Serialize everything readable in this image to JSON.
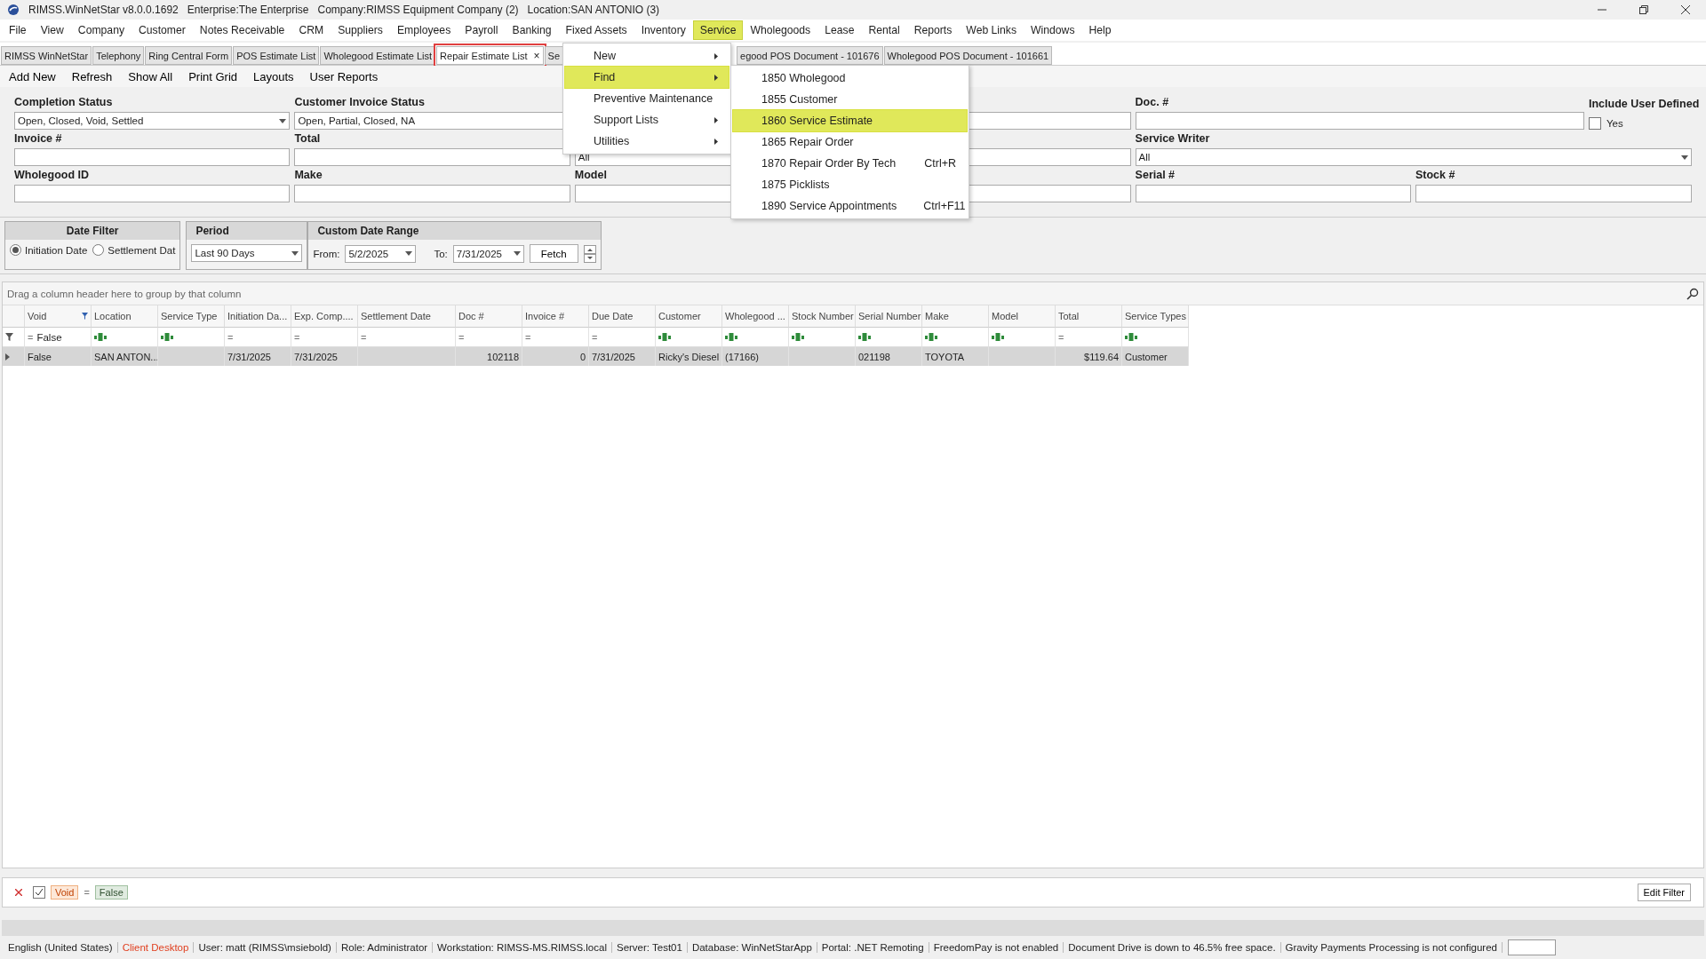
{
  "window": {
    "title": "RIMSS.WinNetStar v8.0.0.1692",
    "context": [
      "Enterprise:The Enterprise",
      "Company:RIMSS Equipment Company (2)",
      "Location:SAN ANTONIO (3)"
    ]
  },
  "menu_bar": [
    {
      "label": "File",
      "selected": false
    },
    {
      "label": "View",
      "selected": false
    },
    {
      "label": "Company",
      "selected": false
    },
    {
      "label": "Customer",
      "selected": false
    },
    {
      "label": "Notes Receivable",
      "selected": false
    },
    {
      "label": "CRM",
      "selected": false
    },
    {
      "label": "Suppliers",
      "selected": false
    },
    {
      "label": "Employees",
      "selected": false
    },
    {
      "label": "Payroll",
      "selected": false
    },
    {
      "label": "Banking",
      "selected": false
    },
    {
      "label": "Fixed Assets",
      "selected": false
    },
    {
      "label": "Inventory",
      "selected": false
    },
    {
      "label": "Service",
      "selected": true
    },
    {
      "label": "Wholegoods",
      "selected": false
    },
    {
      "label": "Lease",
      "selected": false
    },
    {
      "label": "Rental",
      "selected": false
    },
    {
      "label": "Reports",
      "selected": false
    },
    {
      "label": "Web Links",
      "selected": false
    },
    {
      "label": "Windows",
      "selected": false
    },
    {
      "label": "Help",
      "selected": false
    }
  ],
  "tabs": [
    {
      "label": "RIMSS WinNetStar",
      "selected": false
    },
    {
      "label": "Telephony",
      "selected": false
    },
    {
      "label": "Ring Central Form",
      "selected": false
    },
    {
      "label": "POS Estimate List",
      "selected": false
    },
    {
      "label": "Wholegood Estimate List",
      "selected": false
    },
    {
      "label": "Repair Estimate List",
      "selected": true,
      "close": "×"
    },
    {
      "label": "Se",
      "selected": false
    },
    {
      "label": "egood POS Document - 101676",
      "selected": false
    },
    {
      "label": "Wholegood POS Document - 101661",
      "selected": false
    }
  ],
  "toolbar": [
    "Add New",
    "Refresh",
    "Show All",
    "Print Grid",
    "Layouts",
    "User Reports"
  ],
  "filter_form": [
    [
      {
        "kind": "dropdown",
        "label": "Completion Status",
        "value": "Open, Closed, Void, Settled"
      },
      {
        "kind": "text",
        "label": "Customer Invoice Status",
        "value": "Open, Partial, Closed, NA"
      },
      {
        "kind": "text"
      },
      {
        "kind": "text",
        "label": "Doc. #"
      },
      {
        "kind": "checkbox",
        "label": "Include User Defined",
        "option": "Yes",
        "checked": false
      }
    ],
    [
      {
        "kind": "text",
        "label": "Invoice #"
      },
      {
        "kind": "text",
        "label": "Total"
      },
      {
        "kind": "dropdown",
        "value": "All"
      },
      {
        "kind": "text"
      },
      {
        "kind": "dropdown",
        "label": "Service Writer",
        "value": "All"
      }
    ],
    [
      {
        "kind": "text",
        "label": "Wholegood ID"
      },
      {
        "kind": "text",
        "label": "Make"
      },
      {
        "kind": "text",
        "label": "Model"
      },
      {
        "kind": "text"
      },
      {
        "kind": "text",
        "label": "Serial #"
      },
      {
        "kind": "text",
        "label": "Stock #"
      }
    ]
  ],
  "date_filter": {
    "title": "Date Filter",
    "options": [
      {
        "label": "Initiation Date",
        "selected": true
      },
      {
        "label": "Settlement Dat",
        "selected": false
      }
    ],
    "period_title": "Period",
    "period": "Last 90 Days",
    "range_title": "Custom Date Range",
    "from_label": "From:",
    "from": "5/2/2025",
    "to_label": "To:",
    "to": "7/31/2025",
    "fetch": "Fetch"
  },
  "grid": {
    "group_hint": "Drag a column header here to group by that column",
    "columns": [
      {
        "label": "Void",
        "filtered": true
      },
      {
        "label": "Location",
        "filtered": false
      },
      {
        "label": "Service Type",
        "filtered": false
      },
      {
        "label": "Initiation Da...",
        "filtered": false
      },
      {
        "label": "Exp. Comp....",
        "filtered": false
      },
      {
        "label": "Settlement Date",
        "filtered": false
      },
      {
        "label": "Doc #",
        "filtered": false
      },
      {
        "label": "Invoice #",
        "filtered": false
      },
      {
        "label": "Due Date",
        "filtered": false
      },
      {
        "label": "Customer",
        "filtered": false
      },
      {
        "label": "Wholegood ...",
        "filtered": false
      },
      {
        "label": "Stock Number",
        "filtered": false
      },
      {
        "label": "Serial Number",
        "filtered": false
      },
      {
        "label": "Make",
        "filtered": false
      },
      {
        "label": "Model",
        "filtered": false
      },
      {
        "label": "Total",
        "filtered": false
      },
      {
        "label": "Service Types",
        "filtered": false
      }
    ],
    "filter_row": [
      {
        "kind": "equals",
        "operator": "=",
        "value": "False"
      },
      {
        "kind": "text"
      },
      {
        "kind": "text"
      },
      {
        "kind": "equals",
        "operator": "="
      },
      {
        "kind": "equals",
        "operator": "="
      },
      {
        "kind": "equals",
        "operator": "="
      },
      {
        "kind": "equals",
        "operator": "="
      },
      {
        "kind": "equals",
        "operator": "="
      },
      {
        "kind": "equals",
        "operator": "="
      },
      {
        "kind": "text"
      },
      {
        "kind": "text"
      },
      {
        "kind": "text"
      },
      {
        "kind": "text"
      },
      {
        "kind": "text"
      },
      {
        "kind": "text"
      },
      {
        "kind": "equals",
        "operator": "="
      },
      {
        "kind": "text"
      }
    ],
    "rows": [
      {
        "selected": true,
        "cells": [
          {
            "kind": "text",
            "text": "False"
          },
          {
            "kind": "text",
            "text": "SAN ANTON..."
          },
          {
            "kind": "text"
          },
          {
            "kind": "text",
            "text": "7/31/2025"
          },
          {
            "kind": "text",
            "text": "7/31/2025"
          },
          {
            "kind": "text"
          },
          {
            "kind": "number",
            "text": "102118"
          },
          {
            "kind": "number",
            "text": "0"
          },
          {
            "kind": "text",
            "text": "7/31/2025"
          },
          {
            "kind": "text",
            "text": "Ricky's Diesel"
          },
          {
            "kind": "text",
            "text": "(17166)"
          },
          {
            "kind": "text"
          },
          {
            "kind": "text",
            "text": "021198"
          },
          {
            "kind": "text",
            "text": "TOYOTA"
          },
          {
            "kind": "text"
          },
          {
            "kind": "number",
            "text": "$119.64"
          },
          {
            "kind": "text",
            "text": "Customer"
          }
        ]
      }
    ]
  },
  "active_filter": {
    "enabled": true,
    "field": "Void",
    "operator": "=",
    "value": "False",
    "edit": "Edit Filter"
  },
  "service_menu": [
    {
      "label": "New",
      "submenu": true,
      "selected": false
    },
    {
      "label": "Find",
      "submenu": true,
      "selected": true
    },
    {
      "label": "Preventive Maintenance",
      "submenu": false,
      "selected": false
    },
    {
      "label": "Support Lists",
      "submenu": true,
      "selected": false
    },
    {
      "label": "Utilities",
      "submenu": true,
      "selected": false
    }
  ],
  "find_submenu": [
    {
      "label": "1850 Wholegood",
      "selected": false
    },
    {
      "label": "1855 Customer",
      "selected": false
    },
    {
      "label": "1860 Service Estimate",
      "selected": true
    },
    {
      "label": "1865 Repair Order",
      "selected": false
    },
    {
      "label": "1870 Repair Order By Tech",
      "shortcut": "Ctrl+R",
      "selected": false
    },
    {
      "label": "1875 Picklists",
      "selected": false
    },
    {
      "label": "1890 Service Appointments",
      "shortcut": "Ctrl+F11",
      "selected": false
    }
  ],
  "status_bar": [
    {
      "text": "English (United States)",
      "alert": false
    },
    {
      "text": "Client Desktop",
      "alert": true
    },
    {
      "text": "User: matt (RIMSS\\msiebold)",
      "alert": false
    },
    {
      "text": "Role: Administrator",
      "alert": false
    },
    {
      "text": "Workstation: RIMSS-MS.RIMSS.local",
      "alert": false
    },
    {
      "text": "Server: Test01",
      "alert": false
    },
    {
      "text": "Database: WinNetStarApp",
      "alert": false
    },
    {
      "text": "Portal: .NET Remoting",
      "alert": false
    },
    {
      "text": "FreedomPay is not enabled",
      "alert": false
    },
    {
      "text": "Document Drive is down to 46.5% free space.",
      "alert": false
    },
    {
      "text": "Gravity Payments Processing is not configured",
      "alert": false
    }
  ]
}
